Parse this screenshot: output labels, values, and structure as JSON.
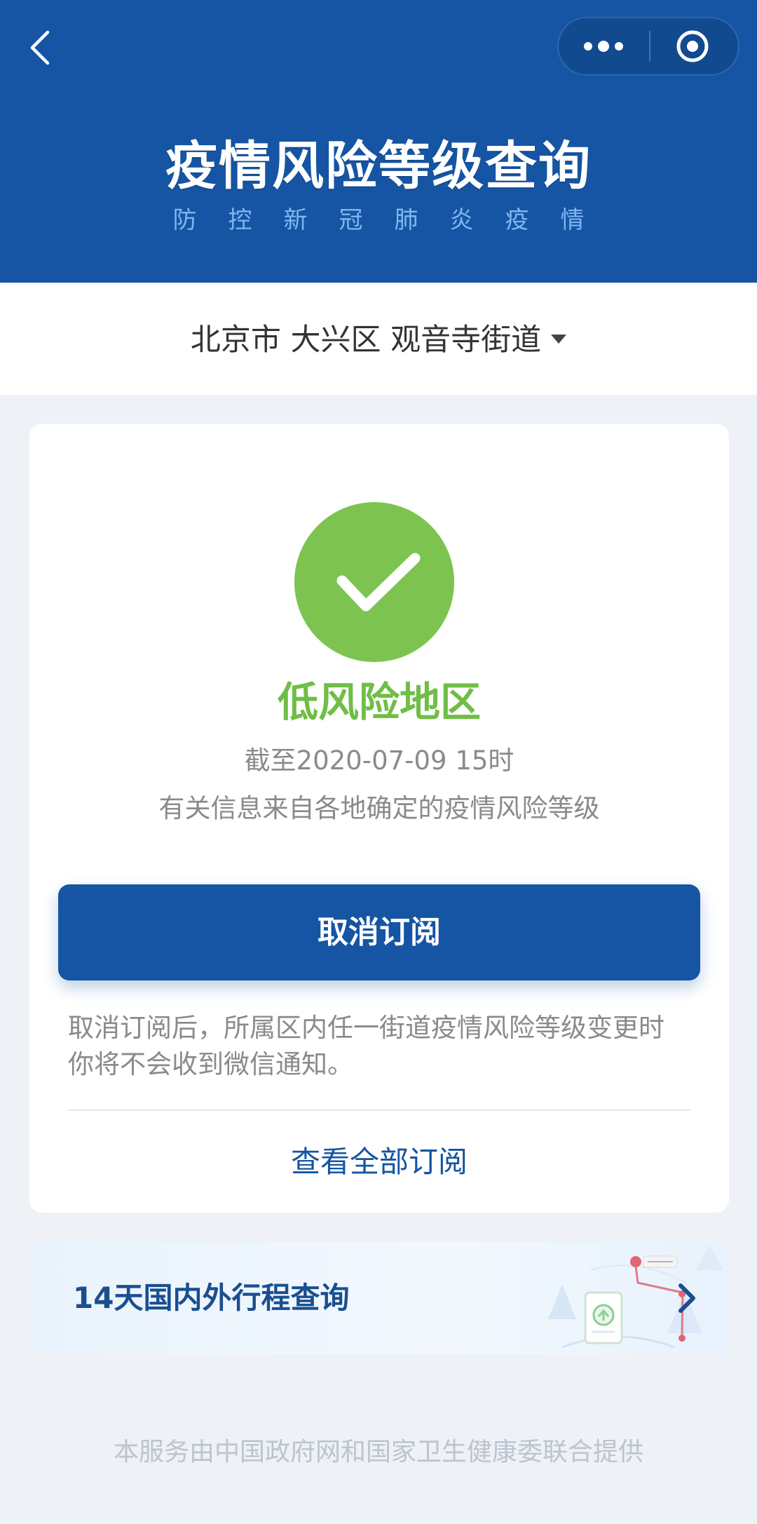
{
  "header": {
    "title": "疫情风险等级查询",
    "subtitle": "防控新冠肺炎疫情"
  },
  "location": {
    "text": "北京市 大兴区 观音寺街道"
  },
  "status": {
    "risk_level": "低风险地区",
    "update_time": "截至2020-07-09 15时",
    "source_note": "有关信息来自各地确定的疫情风险等级"
  },
  "subscription": {
    "button_label": "取消订阅",
    "notice_line1": "取消订阅后，所属区内任一街道疫情风险等级变更时",
    "notice_line2": "你将不会收到微信通知。",
    "view_all_label": "查看全部订阅"
  },
  "trip_query": {
    "label": "14天国内外行程查询"
  },
  "footer": {
    "text": "本服务由中国政府网和国家卫生健康委联合提供"
  },
  "colors": {
    "header_bg": "#1555a3",
    "success_green": "#7cc44f",
    "primary_blue": "#1555a3"
  },
  "icons": {
    "back": "back-chevron-icon",
    "more": "more-dots-icon",
    "close": "close-target-icon",
    "check": "checkmark-icon",
    "caret": "caret-down-icon",
    "arrow": "chevron-right-icon"
  }
}
